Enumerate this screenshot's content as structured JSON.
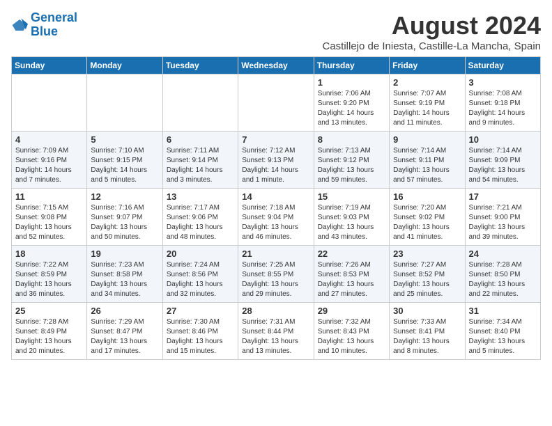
{
  "header": {
    "logo_line1": "General",
    "logo_line2": "Blue",
    "month_year": "August 2024",
    "location": "Castillejo de Iniesta, Castille-La Mancha, Spain"
  },
  "days_of_week": [
    "Sunday",
    "Monday",
    "Tuesday",
    "Wednesday",
    "Thursday",
    "Friday",
    "Saturday"
  ],
  "weeks": [
    [
      {
        "day": "",
        "info": ""
      },
      {
        "day": "",
        "info": ""
      },
      {
        "day": "",
        "info": ""
      },
      {
        "day": "",
        "info": ""
      },
      {
        "day": "1",
        "info": "Sunrise: 7:06 AM\nSunset: 9:20 PM\nDaylight: 14 hours\nand 13 minutes."
      },
      {
        "day": "2",
        "info": "Sunrise: 7:07 AM\nSunset: 9:19 PM\nDaylight: 14 hours\nand 11 minutes."
      },
      {
        "day": "3",
        "info": "Sunrise: 7:08 AM\nSunset: 9:18 PM\nDaylight: 14 hours\nand 9 minutes."
      }
    ],
    [
      {
        "day": "4",
        "info": "Sunrise: 7:09 AM\nSunset: 9:16 PM\nDaylight: 14 hours\nand 7 minutes."
      },
      {
        "day": "5",
        "info": "Sunrise: 7:10 AM\nSunset: 9:15 PM\nDaylight: 14 hours\nand 5 minutes."
      },
      {
        "day": "6",
        "info": "Sunrise: 7:11 AM\nSunset: 9:14 PM\nDaylight: 14 hours\nand 3 minutes."
      },
      {
        "day": "7",
        "info": "Sunrise: 7:12 AM\nSunset: 9:13 PM\nDaylight: 14 hours\nand 1 minute."
      },
      {
        "day": "8",
        "info": "Sunrise: 7:13 AM\nSunset: 9:12 PM\nDaylight: 13 hours\nand 59 minutes."
      },
      {
        "day": "9",
        "info": "Sunrise: 7:14 AM\nSunset: 9:11 PM\nDaylight: 13 hours\nand 57 minutes."
      },
      {
        "day": "10",
        "info": "Sunrise: 7:14 AM\nSunset: 9:09 PM\nDaylight: 13 hours\nand 54 minutes."
      }
    ],
    [
      {
        "day": "11",
        "info": "Sunrise: 7:15 AM\nSunset: 9:08 PM\nDaylight: 13 hours\nand 52 minutes."
      },
      {
        "day": "12",
        "info": "Sunrise: 7:16 AM\nSunset: 9:07 PM\nDaylight: 13 hours\nand 50 minutes."
      },
      {
        "day": "13",
        "info": "Sunrise: 7:17 AM\nSunset: 9:06 PM\nDaylight: 13 hours\nand 48 minutes."
      },
      {
        "day": "14",
        "info": "Sunrise: 7:18 AM\nSunset: 9:04 PM\nDaylight: 13 hours\nand 46 minutes."
      },
      {
        "day": "15",
        "info": "Sunrise: 7:19 AM\nSunset: 9:03 PM\nDaylight: 13 hours\nand 43 minutes."
      },
      {
        "day": "16",
        "info": "Sunrise: 7:20 AM\nSunset: 9:02 PM\nDaylight: 13 hours\nand 41 minutes."
      },
      {
        "day": "17",
        "info": "Sunrise: 7:21 AM\nSunset: 9:00 PM\nDaylight: 13 hours\nand 39 minutes."
      }
    ],
    [
      {
        "day": "18",
        "info": "Sunrise: 7:22 AM\nSunset: 8:59 PM\nDaylight: 13 hours\nand 36 minutes."
      },
      {
        "day": "19",
        "info": "Sunrise: 7:23 AM\nSunset: 8:58 PM\nDaylight: 13 hours\nand 34 minutes."
      },
      {
        "day": "20",
        "info": "Sunrise: 7:24 AM\nSunset: 8:56 PM\nDaylight: 13 hours\nand 32 minutes."
      },
      {
        "day": "21",
        "info": "Sunrise: 7:25 AM\nSunset: 8:55 PM\nDaylight: 13 hours\nand 29 minutes."
      },
      {
        "day": "22",
        "info": "Sunrise: 7:26 AM\nSunset: 8:53 PM\nDaylight: 13 hours\nand 27 minutes."
      },
      {
        "day": "23",
        "info": "Sunrise: 7:27 AM\nSunset: 8:52 PM\nDaylight: 13 hours\nand 25 minutes."
      },
      {
        "day": "24",
        "info": "Sunrise: 7:28 AM\nSunset: 8:50 PM\nDaylight: 13 hours\nand 22 minutes."
      }
    ],
    [
      {
        "day": "25",
        "info": "Sunrise: 7:28 AM\nSunset: 8:49 PM\nDaylight: 13 hours\nand 20 minutes."
      },
      {
        "day": "26",
        "info": "Sunrise: 7:29 AM\nSunset: 8:47 PM\nDaylight: 13 hours\nand 17 minutes."
      },
      {
        "day": "27",
        "info": "Sunrise: 7:30 AM\nSunset: 8:46 PM\nDaylight: 13 hours\nand 15 minutes."
      },
      {
        "day": "28",
        "info": "Sunrise: 7:31 AM\nSunset: 8:44 PM\nDaylight: 13 hours\nand 13 minutes."
      },
      {
        "day": "29",
        "info": "Sunrise: 7:32 AM\nSunset: 8:43 PM\nDaylight: 13 hours\nand 10 minutes."
      },
      {
        "day": "30",
        "info": "Sunrise: 7:33 AM\nSunset: 8:41 PM\nDaylight: 13 hours\nand 8 minutes."
      },
      {
        "day": "31",
        "info": "Sunrise: 7:34 AM\nSunset: 8:40 PM\nDaylight: 13 hours\nand 5 minutes."
      }
    ]
  ]
}
